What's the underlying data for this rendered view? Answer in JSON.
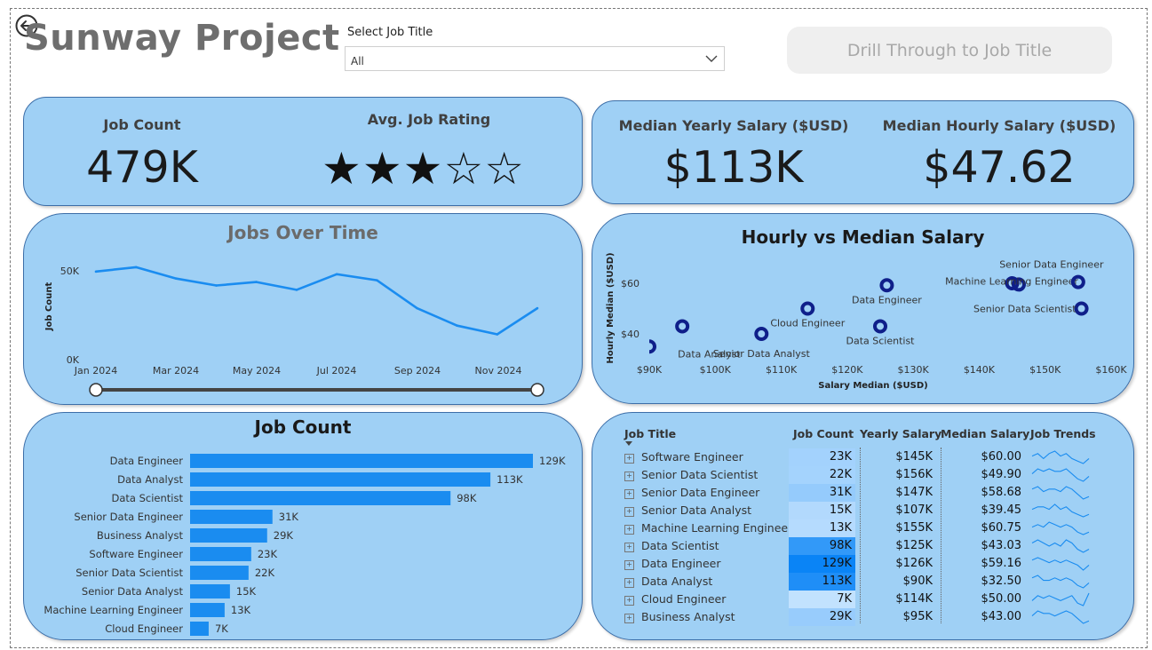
{
  "header": {
    "title": "Sunway Project",
    "slicer_label": "Select Job Title",
    "slicer_value": "All",
    "drill_label": "Drill Through to Job Title"
  },
  "kpis": {
    "job_count_label": "Job Count",
    "job_count_value": "479K",
    "rating_label": "Avg. Job Rating",
    "rating_value": 3,
    "rating_max": 5,
    "rating_stars": "★★★☆☆",
    "median_yearly_label": "Median Yearly Salary ($USD)",
    "median_yearly_value": "$113K",
    "median_hourly_label": "Median Hourly Salary ($USD)",
    "median_hourly_value": "$47.62"
  },
  "colors": {
    "panel": "#9fd0f5",
    "bar": "#1a8cf0",
    "line": "#1a8cf0",
    "scatter": "#0f1f8a"
  },
  "chart_data": [
    {
      "type": "line",
      "title": "Jobs Over Time",
      "xlabel": "",
      "ylabel": "Job Count",
      "x": [
        "Jan 2024",
        "Feb 2024",
        "Mar 2024",
        "Apr 2024",
        "May 2024",
        "Jun 2024",
        "Jul 2024",
        "Aug 2024",
        "Sep 2024",
        "Oct 2024",
        "Nov 2024",
        "Dec 2024"
      ],
      "x_ticks": [
        "Jan 2024",
        "Mar 2024",
        "May 2024",
        "Jul 2024",
        "Sep 2024",
        "Nov 2024"
      ],
      "y_ticks": [
        "0K",
        "50K"
      ],
      "values": [
        50000,
        52500,
        46000,
        42000,
        44000,
        39500,
        48500,
        45000,
        29000,
        19000,
        14000,
        29000
      ],
      "ylim": [
        0,
        55000
      ]
    },
    {
      "type": "scatter",
      "title": "Hourly vs Median Salary",
      "xlabel": "Salary Median ($USD)",
      "ylabel": "Hourly Median ($USD)",
      "x_ticks": [
        "$90K",
        "$100K",
        "$110K",
        "$120K",
        "$130K",
        "$140K",
        "$150K",
        "$160K"
      ],
      "y_ticks": [
        "$40",
        "$60"
      ],
      "xlim": [
        90000,
        160000
      ],
      "ylim": [
        33,
        68
      ],
      "points": [
        {
          "x": 90000,
          "y": 35.0,
          "label": ""
        },
        {
          "x": 95000,
          "y": 43.0,
          "label": "Data Analyst"
        },
        {
          "x": 107000,
          "y": 40.0,
          "label": "Senior Data Analyst"
        },
        {
          "x": 114000,
          "y": 50.0,
          "label": "Cloud Engineer"
        },
        {
          "x": 125000,
          "y": 43.0,
          "label": "Data Scientist"
        },
        {
          "x": 126000,
          "y": 59.2,
          "label": "Data Engineer"
        },
        {
          "x": 145000,
          "y": 60.0,
          "label": ""
        },
        {
          "x": 146000,
          "y": 59.5,
          "label": "Machine Learning Engineer"
        },
        {
          "x": 155000,
          "y": 60.5,
          "label": "Senior Data Engineer"
        },
        {
          "x": 155500,
          "y": 50.0,
          "label": "Senior Data Scientist"
        }
      ]
    },
    {
      "type": "bar",
      "title": "Job Count",
      "categories": [
        "Data Engineer",
        "Data Analyst",
        "Data Scientist",
        "Senior Data Engineer",
        "Business Analyst",
        "Software Engineer",
        "Senior Data Scientist",
        "Senior Data Analyst",
        "Machine Learning Engineer",
        "Cloud Engineer"
      ],
      "values": [
        129,
        113,
        98,
        31,
        29,
        23,
        22,
        15,
        13,
        7
      ],
      "value_labels": [
        "129K",
        "113K",
        "98K",
        "31K",
        "29K",
        "23K",
        "22K",
        "15K",
        "13K",
        "7K"
      ],
      "xlim": [
        0,
        129
      ]
    }
  ],
  "table": {
    "headers": [
      "Job Title",
      "Job Count",
      "Yearly Salary",
      "Median Salary",
      "Job Trends"
    ],
    "rows": [
      {
        "title": "Software Engineer",
        "count": "23K",
        "count_num": 23,
        "yearly": "$145K",
        "median": "$60.00",
        "trend": [
          4,
          5,
          3,
          5,
          6,
          4,
          5,
          3,
          2,
          1,
          3
        ]
      },
      {
        "title": "Senior Data Scientist",
        "count": "22K",
        "count_num": 22,
        "yearly": "$156K",
        "median": "$49.90",
        "trend": [
          4,
          6,
          5,
          6,
          5,
          5,
          6,
          4,
          2,
          1,
          3
        ]
      },
      {
        "title": "Senior Data Engineer",
        "count": "31K",
        "count_num": 31,
        "yearly": "$147K",
        "median": "$58.68",
        "trend": [
          5,
          6,
          4,
          5,
          5,
          4,
          6,
          5,
          3,
          1,
          2
        ]
      },
      {
        "title": "Senior Data Analyst",
        "count": "15K",
        "count_num": 15,
        "yearly": "$107K",
        "median": "$39.45",
        "trend": [
          4,
          5,
          5,
          4,
          6,
          4,
          5,
          3,
          2,
          1,
          2
        ]
      },
      {
        "title": "Machine Learning Engineer",
        "count": "13K",
        "count_num": 13,
        "yearly": "$155K",
        "median": "$60.75",
        "trend": [
          4,
          5,
          4,
          6,
          5,
          4,
          5,
          4,
          2,
          1,
          2
        ]
      },
      {
        "title": "Data Scientist",
        "count": "98K",
        "count_num": 98,
        "yearly": "$125K",
        "median": "$43.03",
        "trend": [
          5,
          6,
          5,
          4,
          5,
          4,
          6,
          5,
          3,
          2,
          3
        ]
      },
      {
        "title": "Data Engineer",
        "count": "129K",
        "count_num": 129,
        "yearly": "$126K",
        "median": "$59.16",
        "trend": [
          5,
          6,
          5,
          4,
          5,
          4,
          5,
          4,
          3,
          1,
          3
        ]
      },
      {
        "title": "Data Analyst",
        "count": "113K",
        "count_num": 113,
        "yearly": "$90K",
        "median": "$32.50",
        "trend": [
          5,
          6,
          4,
          4,
          5,
          4,
          5,
          4,
          2,
          1,
          3
        ]
      },
      {
        "title": "Cloud Engineer",
        "count": "7K",
        "count_num": 7,
        "yearly": "$114K",
        "median": "$50.00",
        "trend": [
          3,
          5,
          4,
          5,
          4,
          3,
          4,
          5,
          2,
          1,
          6
        ]
      },
      {
        "title": "Business Analyst",
        "count": "29K",
        "count_num": 29,
        "yearly": "$95K",
        "median": "$43.00",
        "trend": [
          4,
          6,
          5,
          5,
          4,
          5,
          6,
          5,
          3,
          1,
          2
        ]
      }
    ]
  }
}
